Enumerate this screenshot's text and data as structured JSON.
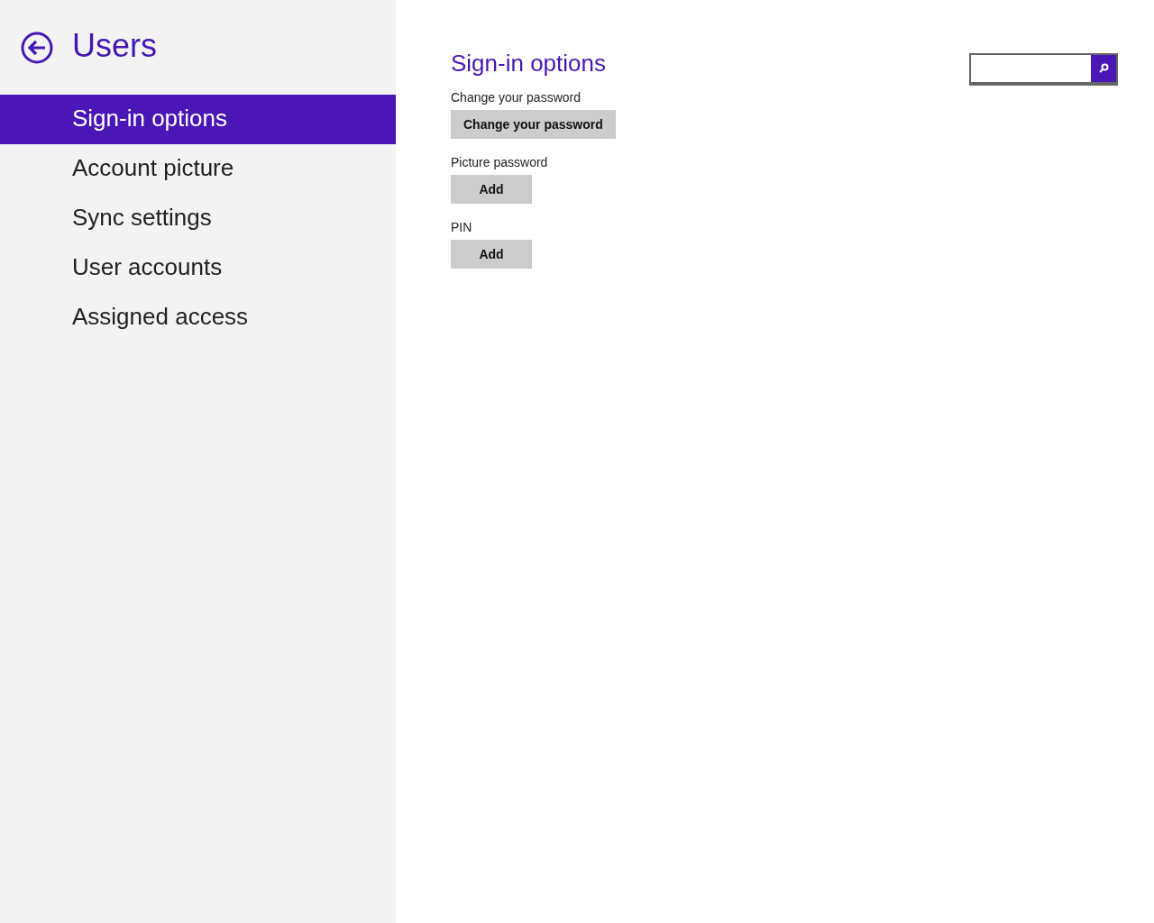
{
  "header": {
    "title": "Users"
  },
  "nav": [
    {
      "label": "Sign-in options",
      "selected": true
    },
    {
      "label": "Account picture",
      "selected": false
    },
    {
      "label": "Sync settings",
      "selected": false
    },
    {
      "label": "User accounts",
      "selected": false
    },
    {
      "label": "Assigned access",
      "selected": false
    }
  ],
  "content": {
    "title": "Sign-in options",
    "sections": [
      {
        "label": "Change your password",
        "button": "Change your password"
      },
      {
        "label": "Picture password",
        "button": "Add"
      },
      {
        "label": "PIN",
        "button": "Add"
      }
    ]
  }
}
